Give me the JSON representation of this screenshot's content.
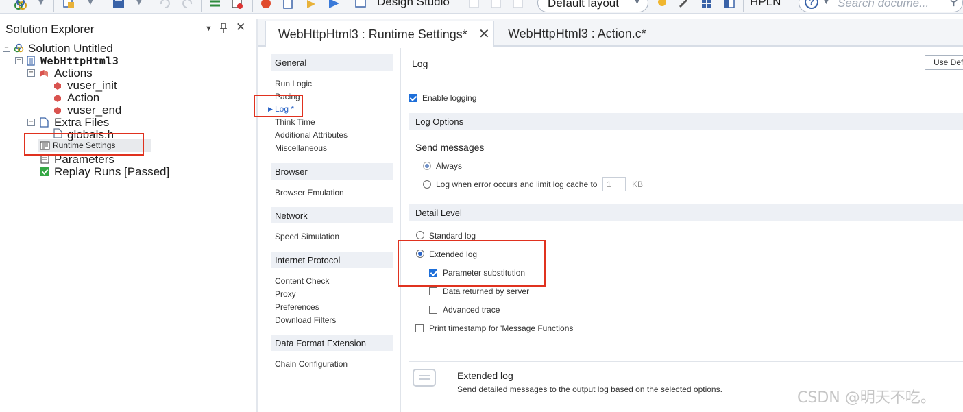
{
  "toolbar": {
    "design_studio": "Design Studio",
    "layout": "Default layout",
    "hpln": "HPLN",
    "search_placeholder": "Search docume..."
  },
  "explorer": {
    "title": "Solution Explorer",
    "tree": {
      "solution": "Solution Untitled",
      "project": "WebHttpHtml3",
      "actions": "Actions",
      "vuser_init": "vuser_init",
      "action": "Action",
      "vuser_end": "vuser_end",
      "extra_files": "Extra Files",
      "globals": "globals.h",
      "runtime_settings": "Runtime Settings",
      "parameters": "Parameters",
      "replay_runs": "Replay Runs [Passed]"
    }
  },
  "tabs": {
    "runtime": "WebHttpHtml3 : Runtime Settings*",
    "action": "WebHttpHtml3 : Action.c*"
  },
  "nav": {
    "general": "General",
    "run_logic": "Run Logic",
    "pacing": "Pacing",
    "log": "Log *",
    "think_time": "Think Time",
    "additional_attributes": "Additional Attributes",
    "miscellaneous": "Miscellaneous",
    "browser": "Browser",
    "browser_emulation": "Browser Emulation",
    "network": "Network",
    "speed_simulation": "Speed Simulation",
    "internet_protocol": "Internet Protocol",
    "content_check": "Content Check",
    "proxy": "Proxy",
    "preferences": "Preferences",
    "download_filters": "Download Filters",
    "data_format_extension": "Data Format Extension",
    "chain_configuration": "Chain Configuration"
  },
  "main": {
    "title": "Log",
    "use_default": "Use Def",
    "enable_logging": "Enable logging",
    "log_options": "Log Options",
    "send_messages": "Send messages",
    "always": "Always",
    "log_when_error": "Log when error occurs and limit log cache to",
    "cache_value": "1",
    "kb": "KB",
    "detail_level": "Detail Level",
    "standard_log": "Standard log",
    "extended_log": "Extended log",
    "parameter_substitution": "Parameter substitution",
    "data_returned": "Data returned by server",
    "advanced_trace": "Advanced trace",
    "print_timestamp": "Print timestamp for 'Message Functions'",
    "info_title": "Extended log",
    "info_desc": "Send detailed messages to the output log based on the selected options."
  },
  "watermark": "CSDN @明天不吃。",
  "colors": {
    "accent": "#2b64c6",
    "highlight": "#e0321f",
    "section_bg": "#edf0f5"
  }
}
